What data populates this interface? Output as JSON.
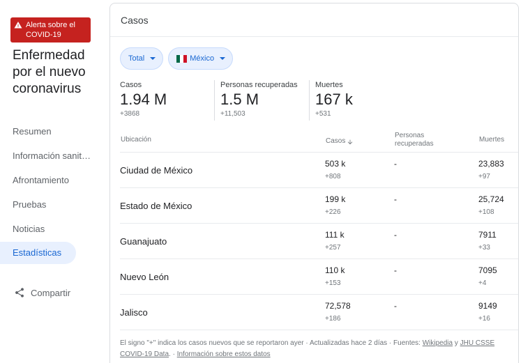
{
  "alert": {
    "label": "Alerta sobre el COVID-19",
    "icon": "warning-icon"
  },
  "sidebar": {
    "title": "Enfermedad por el nuevo coronavirus",
    "items": [
      {
        "label": "Resumen"
      },
      {
        "label": "Información sanitaria"
      },
      {
        "label": "Afrontamiento"
      },
      {
        "label": "Pruebas"
      },
      {
        "label": "Noticias"
      },
      {
        "label": "Estadísticas",
        "active": true
      }
    ],
    "share_label": "Compartir"
  },
  "card": {
    "title": "Casos",
    "filters": {
      "metric": "Total",
      "location": "México"
    },
    "stats": [
      {
        "label": "Casos",
        "value": "1.94 M",
        "delta": "+3868"
      },
      {
        "label": "Personas recuperadas",
        "value": "1.5 M",
        "delta": "+11,503"
      },
      {
        "label": "Muertes",
        "value": "167 k",
        "delta": "+531"
      }
    ],
    "table": {
      "headers": {
        "location": "Ubicación",
        "cases": "Casos",
        "recovered": "Personas recuperadas",
        "deaths": "Muertes"
      },
      "rows": [
        {
          "location": "Ciudad de México",
          "cases": "503 k",
          "cases_delta": "+808",
          "recovered": "-",
          "deaths": "23,883",
          "deaths_delta": "+97"
        },
        {
          "location": "Estado de México",
          "cases": "199 k",
          "cases_delta": "+226",
          "recovered": "-",
          "deaths": "25,724",
          "deaths_delta": "+108"
        },
        {
          "location": "Guanajuato",
          "cases": "111 k",
          "cases_delta": "+257",
          "recovered": "-",
          "deaths": "7911",
          "deaths_delta": "+33"
        },
        {
          "location": "Nuevo León",
          "cases": "110 k",
          "cases_delta": "+153",
          "recovered": "-",
          "deaths": "7095",
          "deaths_delta": "+4"
        },
        {
          "location": "Jalisco",
          "cases": "72,578",
          "cases_delta": "+186",
          "recovered": "-",
          "deaths": "9149",
          "deaths_delta": "+16"
        }
      ]
    },
    "footnote": {
      "text": "El signo \"+\" indica los casos nuevos que se reportaron ayer · Actualizadas hace 2 días · Fuentes:",
      "link1": "Wikipedia",
      "and": "y",
      "link2": "JHU CSSE COVID-19 Data",
      "sep": ". ·",
      "link3": "Información sobre estos datos"
    }
  },
  "colors": {
    "accent": "#1967d2",
    "alert": "#c5221f",
    "chip_bg": "#e8f0fe"
  }
}
